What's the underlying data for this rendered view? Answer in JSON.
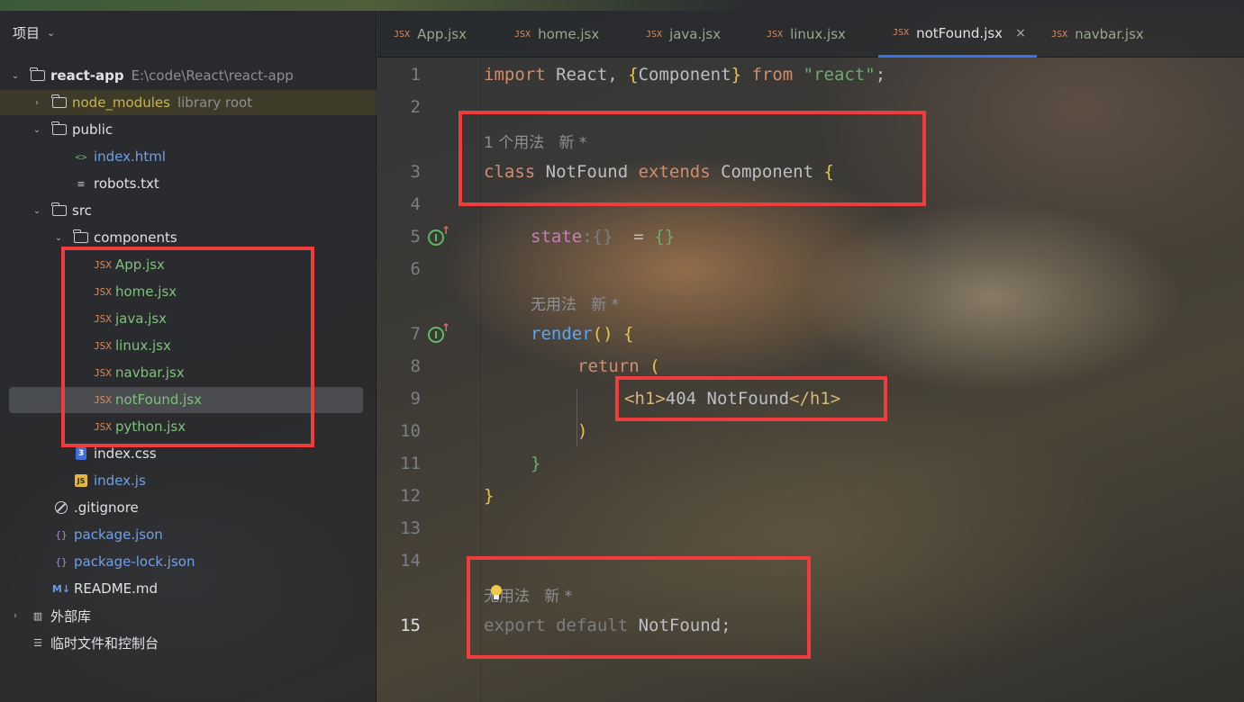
{
  "project_panel": {
    "title": "项目",
    "tree": [
      {
        "id": "root",
        "label": "react-app",
        "path": "E:\\code\\React\\react-app"
      },
      {
        "id": "node_modules",
        "label": "node_modules",
        "note": "library root"
      },
      {
        "id": "public",
        "label": "public"
      },
      {
        "id": "index_html",
        "label": "index.html"
      },
      {
        "id": "robots",
        "label": "robots.txt"
      },
      {
        "id": "src",
        "label": "src"
      },
      {
        "id": "components",
        "label": "components"
      },
      {
        "id": "app",
        "label": "App.jsx"
      },
      {
        "id": "home",
        "label": "home.jsx"
      },
      {
        "id": "java",
        "label": "java.jsx"
      },
      {
        "id": "linux",
        "label": "linux.jsx"
      },
      {
        "id": "navbar",
        "label": "navbar.jsx"
      },
      {
        "id": "notfound",
        "label": "notFound.jsx"
      },
      {
        "id": "python",
        "label": "python.jsx"
      },
      {
        "id": "index_css",
        "label": "index.css"
      },
      {
        "id": "index_js",
        "label": "index.js"
      },
      {
        "id": "gitignore",
        "label": ".gitignore"
      },
      {
        "id": "package",
        "label": "package.json"
      },
      {
        "id": "package_lock",
        "label": "package-lock.json"
      },
      {
        "id": "readme",
        "label": "README.md"
      },
      {
        "id": "external",
        "label": "外部库"
      },
      {
        "id": "scratches",
        "label": "临时文件和控制台"
      }
    ],
    "icons": {
      "jsx": "JSX",
      "html": "<>",
      "css": "3",
      "js": "JS",
      "json": "{}",
      "md": "M↓"
    }
  },
  "tabs": [
    {
      "label": "App.jsx"
    },
    {
      "label": "home.jsx"
    },
    {
      "label": "java.jsx"
    },
    {
      "label": "linux.jsx"
    },
    {
      "label": "notFound.jsx",
      "close": "×"
    },
    {
      "label": "navbar.jsx"
    }
  ],
  "editor": {
    "line_numbers": [
      "1",
      "2",
      "3",
      "4",
      "5",
      "6",
      "7",
      "8",
      "9",
      "10",
      "11",
      "12",
      "13",
      "14",
      "15"
    ],
    "hints": {
      "class_usage": "1 个用法   新 *",
      "render_usage": "无用法   新 *",
      "export_usage": "无用法   新 *"
    },
    "code": {
      "l1_import": "import",
      "l1_react": " React, ",
      "l1_ob": "{",
      "l1_component": "Component",
      "l1_cb": "}",
      "l1_from": " from ",
      "l1_str": "\"react\"",
      "l1_semi": ";",
      "l3_class": "class",
      "l3_name": " NotFound ",
      "l3_extends": "extends",
      "l3_comp": " Component ",
      "l3_brace": "{",
      "l5_state": "state",
      "l5_hint": ":{}",
      "l5_eq": "  = ",
      "l5_val": "{}",
      "l7_render": "render",
      "l7_paren": "()",
      "l7_brace": " {",
      "l8_return": "return",
      "l8_paren": " (",
      "l9_open": "<h1>",
      "l9_text": "404 NotFound",
      "l9_close": "</h1>",
      "l10_paren": ")",
      "l11_brace": "}",
      "l12_brace": "}",
      "l15_export": "export",
      "l15_default": " default ",
      "l15_name": "NotFound",
      "l15_semi": ";"
    }
  },
  "colors": {
    "annotation_box": "#f03c3c",
    "active_tab_underline": "#3574f0",
    "keyword": "#cf8e6d",
    "string": "#6aab73"
  }
}
